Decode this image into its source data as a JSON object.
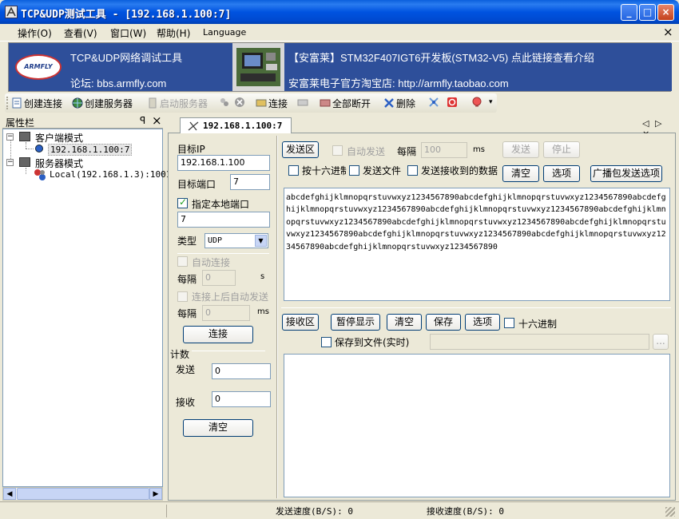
{
  "window": {
    "title": "TCP&UDP测试工具 - [192.168.1.100:7]",
    "buttons": {
      "minimize": "_",
      "maximize": "□",
      "close": "×"
    }
  },
  "menu": {
    "items": [
      "操作(O)",
      "查看(V)",
      "窗口(W)",
      "帮助(H)",
      "Language"
    ],
    "close": "×"
  },
  "banner": {
    "logo_text": "ARMFLY",
    "line1": "TCP&UDP网络调试工具",
    "line2": "论坛: bbs.armfly.com",
    "ad_line1": "【安富莱】STM32F407IGT6开发板(STM32-V5) 点此链接查看介绍",
    "ad_line2": "安富莱电子官方淘宝店: http://armfly.taobao.com"
  },
  "toolbar": {
    "create_connection": "创建连接",
    "create_server": "创建服务器",
    "start_server": "启动服务器",
    "connect": "连接",
    "disconnect_all": "全部断开",
    "delete": "删除"
  },
  "sidebar": {
    "title": "属性栏",
    "pin": "ᵖ",
    "close": "×",
    "tree": {
      "client_mode": "客户端模式",
      "client_item": "192.168.1.100:7",
      "server_mode": "服务器模式",
      "server_item": "Local(192.168.1.3):1001"
    }
  },
  "tab": {
    "label": "192.168.1.100:7",
    "nav": "◁ ▷ ×"
  },
  "connection": {
    "target_ip_label": "目标IP",
    "target_ip": "192.168.1.100",
    "target_port_label": "目标端口",
    "target_port": "7",
    "local_port_check": "指定本地端口",
    "local_port_checked": true,
    "local_port": "7",
    "type_label": "类型",
    "type_value": "UDP",
    "auto_connect": "自动连接",
    "interval_label": "每隔",
    "interval_value": "0",
    "interval_unit": "s",
    "auto_send_after": "连接上后自动发送",
    "interval2_label": "每隔",
    "interval2_value": "0",
    "interval2_unit": "ms",
    "connect_button": "连接"
  },
  "counter": {
    "title": "计数",
    "send_label": "发送",
    "send_value": "0",
    "recv_label": "接收",
    "recv_value": "0",
    "clear_button": "清空"
  },
  "send_area": {
    "title": "发送区",
    "auto_send": "自动发送",
    "every_label": "每隔",
    "every_value": "100",
    "every_unit": "ms",
    "send_button": "发送",
    "stop_button": "停止",
    "hex_send": "按十六进制",
    "send_file": "发送文件",
    "send_received": "发送接收到的数据",
    "clear_button": "清空",
    "options_button": "选项",
    "broadcast_button": "广播包发送选项",
    "content": "abcdefghijklmnopqrstuvwxyz1234567890abcdefghijklmnopqrstuvwxyz1234567890abcdefghijklmnopqrstuvwxyz1234567890abcdefghijklmnopqrstuvwxyz1234567890abcdefghijklmnopqrstuvwxyz1234567890abcdefghijklmnopqrstuvwxyz1234567890abcdefghijklmnopqrstuvwxyz1234567890abcdefghijklmnopqrstuvwxyz1234567890abcdefghijklmnopqrstuvwxyz1234567890abcdefghijklmnopqrstuvwxyz1234567890"
  },
  "recv_area": {
    "title": "接收区",
    "pause_button": "暂停显示",
    "clear_button": "清空",
    "save_button": "保存",
    "options_button": "选项",
    "hex": "十六进制",
    "save_to_file": "保存到文件(实时)",
    "browse_button": "..."
  },
  "status": {
    "send_speed": "发送速度(B/S): 0",
    "recv_speed": "接收速度(B/S): 0"
  }
}
